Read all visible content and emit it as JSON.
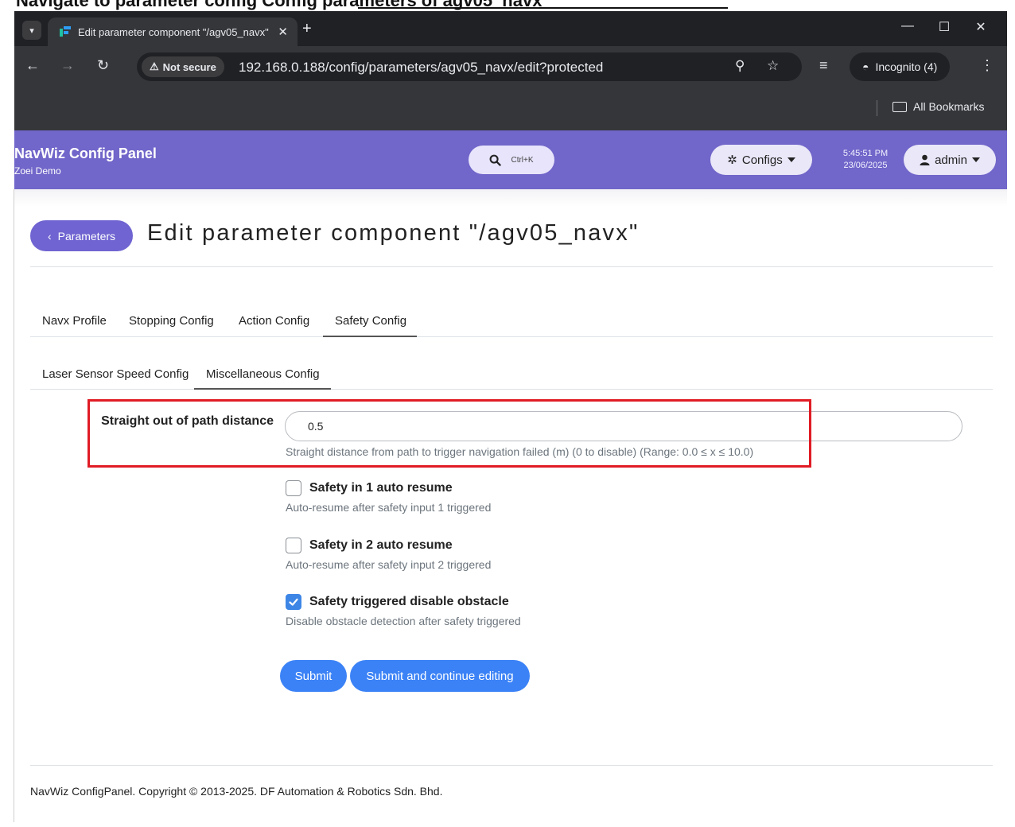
{
  "caption": {
    "text": "Navigate to parameter config  Config parameters of agv05_navx"
  },
  "browser": {
    "tab_title": "Edit parameter component \"/agv05_navx\"",
    "not_secure_label": "Not secure",
    "url": "192.168.0.188/config/parameters/agv05_navx/edit?protected",
    "incognito_label": "Incognito (4)",
    "bookmarks_label": "All Bookmarks"
  },
  "appbar": {
    "title": "NavWiz Config Panel",
    "subtitle": "Zoei Demo",
    "search_shortcut": "Ctrl+K",
    "configs_label": "Configs",
    "time": "5:45:51 PM",
    "date": "23/06/2025",
    "user": "admin"
  },
  "page": {
    "back_label": "Parameters",
    "title": "Edit parameter component \"/agv05_navx\""
  },
  "tabs": [
    "Navx Profile",
    "Stopping Config",
    "Action Config",
    "Safety Config"
  ],
  "active_tab": "Safety Config",
  "subtabs": [
    "Laser Sensor Speed Config",
    "Miscellaneous Config"
  ],
  "active_subtab": "Miscellaneous Config",
  "form": {
    "distance_field": {
      "label": "Straight out of path distance",
      "value": "0.5",
      "help": "Straight distance from path to trigger navigation failed (m) (0 to disable) (Range: 0.0 ≤ x ≤ 10.0)"
    },
    "checkboxes": [
      {
        "label": "Safety in 1 auto resume",
        "help": "Auto-resume after safety input 1 triggered",
        "checked": false
      },
      {
        "label": "Safety in 2 auto resume",
        "help": "Auto-resume after safety input 2 triggered",
        "checked": false
      },
      {
        "label": "Safety triggered disable obstacle",
        "help": "Disable obstacle detection after safety triggered",
        "checked": true
      }
    ],
    "submit_label": "Submit",
    "submit_continue_label": "Submit and continue editing"
  },
  "footer": "NavWiz ConfigPanel. Copyright © 2013-2025. DF Automation & Robotics Sdn. Bhd.",
  "colors": {
    "appbar": "#7166c9",
    "primary_button": "#3b82f6",
    "highlight": "#e01b24"
  }
}
